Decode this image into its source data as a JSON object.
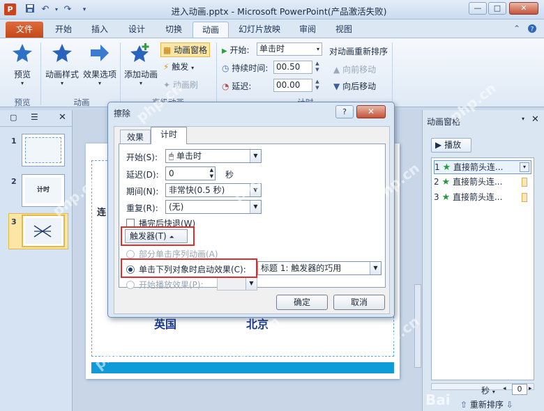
{
  "window": {
    "app_letter": "P",
    "title": "进入动画.pptx - Microsoft PowerPoint(产品激活失败)",
    "minimize": "—",
    "maximize": "□",
    "close": "✕"
  },
  "tabs": [
    "文件",
    "开始",
    "插入",
    "设计",
    "切换",
    "动画",
    "幻灯片放映",
    "审阅",
    "视图"
  ],
  "ribbon": {
    "preview_label": "预览",
    "preview_group": "预览",
    "anim_style_label": "动画样式",
    "effect_options_label": "效果选项",
    "anim_group": "动画",
    "add_anim_label": "添加动画",
    "anim_pane_label": "动画窗格",
    "trigger_label": "触发",
    "anim_painter_label": "动画刷",
    "advanced_group": "高级动画",
    "start_label": "开始:",
    "start_value": "单击时",
    "duration_label": "持续时间:",
    "duration_value": "00.50",
    "delay_label": "延迟:",
    "delay_value": "00.00",
    "timing_group": "计时",
    "reorder_label": "对动画重新排序",
    "move_earlier": "向前移动",
    "move_later": "向后移动"
  },
  "slides": [
    "1",
    "2",
    "3"
  ],
  "slide_thumb2_text": "计时",
  "slide_partial_texts": [
    "连",
    "英国",
    "北京",
    "1",
    "2",
    "3"
  ],
  "anim_pane": {
    "title": "动画窗格",
    "play_label": "播放",
    "items": [
      {
        "num": "1",
        "label": "直接箭头连..."
      },
      {
        "num": "2",
        "label": "直接箭头连..."
      },
      {
        "num": "3",
        "label": "直接箭头连..."
      }
    ],
    "seconds_label": "秒",
    "zoom_value": "0",
    "reorder_label": "重新排序"
  },
  "dialog": {
    "title": "擦除",
    "help": "?",
    "close": "✕",
    "tab_effect": "效果",
    "tab_timing": "计时",
    "start_label": "开始(S):",
    "start_value": "单击时",
    "delay_label": "延迟(D):",
    "delay_value": "0",
    "delay_unit": "秒",
    "period_label": "期间(N):",
    "period_value": "非常快(0.5 秒)",
    "repeat_label": "重复(R):",
    "repeat_value": "(无)",
    "rewind_label": "播完后快退(W)",
    "trigger_label": "触发器(T)",
    "option1_label": "部分单击序列动画(A)",
    "option2_label": "单击下列对象时启动效果(C):",
    "option2_value": "标题 1: 触发器的巧用",
    "option3_label": "开始播放效果(P):",
    "ok": "确定",
    "cancel": "取消"
  },
  "watermarks": [
    "php.cn",
    "php.cn",
    "php.cn",
    "php.cn",
    "php.cn",
    "php.cn",
    "php.cn",
    "php.cn"
  ],
  "corner_brand": "Bai"
}
